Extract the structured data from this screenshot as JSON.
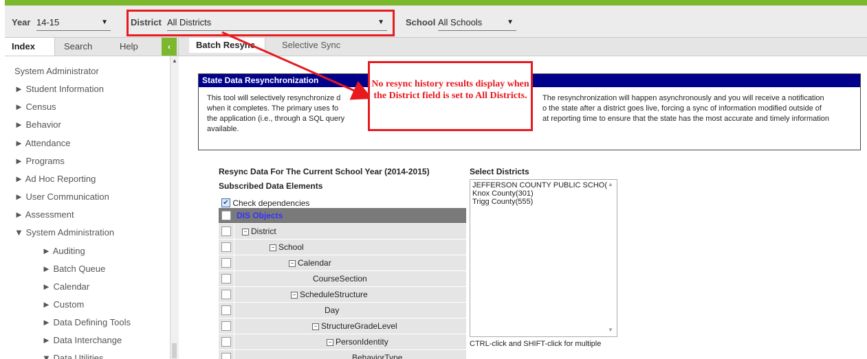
{
  "topbar": {
    "year_label": "Year",
    "year_value": "14-15",
    "district_label": "District",
    "district_value": "All Districts",
    "school_label": "School",
    "school_value": "All Schools"
  },
  "sidebar": {
    "tabs": [
      "Index",
      "Search",
      "Help"
    ],
    "collapse_glyph": "‹",
    "items": [
      {
        "label": "System Administrator"
      },
      {
        "label": "► Student Information"
      },
      {
        "label": "► Census"
      },
      {
        "label": "► Behavior"
      },
      {
        "label": "► Attendance"
      },
      {
        "label": "► Programs"
      },
      {
        "label": "► Ad Hoc Reporting"
      },
      {
        "label": "► User Communication"
      },
      {
        "label": "► Assessment"
      },
      {
        "label": "▼ System Administration"
      },
      {
        "label": "► Auditing"
      },
      {
        "label": "► Batch Queue"
      },
      {
        "label": "► Calendar"
      },
      {
        "label": "► Custom"
      },
      {
        "label": "► Data Defining Tools"
      },
      {
        "label": "► Data Interchange"
      },
      {
        "label": "▼ Data Utilities"
      }
    ]
  },
  "main": {
    "tabs": [
      "Batch Resync",
      "Selective Sync"
    ],
    "panel": {
      "title": "State Data Resynchronization",
      "line1_a": "This tool will selectively resynchronize d",
      "line1_b": "The resynchronization will happen asynchronously and you will receive a notification",
      "line2_a": "when it completes. The primary uses fo",
      "line2_b": "o the state after a district goes live, forcing a sync of information modified outside of",
      "line3_a": "the application (i.e., through a SQL query",
      "line3_b": "at reporting time to ensure that the state has the most accurate and timely information",
      "line4": "available."
    },
    "resync_heading": "Resync Data For The Current School Year (2014-2015)",
    "subscribed_heading": "Subscribed Data Elements",
    "check_dependencies": "Check dependencies",
    "tree": [
      {
        "label": "DIS Objects",
        "indent": 0,
        "toggle": false,
        "head": true
      },
      {
        "label": "District",
        "indent": 1,
        "toggle": true
      },
      {
        "label": "School",
        "indent": 2,
        "toggle": true
      },
      {
        "label": "Calendar",
        "indent": 3,
        "toggle": true
      },
      {
        "label": "CourseSection",
        "indent": 5,
        "toggle": false
      },
      {
        "label": "ScheduleStructure",
        "indent": 4,
        "toggle": true
      },
      {
        "label": "Day",
        "indent": 5,
        "toggle": false
      },
      {
        "label": "StructureGradeLevel",
        "indent": 5,
        "toggle": true
      },
      {
        "label": "PersonIdentity",
        "indent": 6,
        "toggle": true
      },
      {
        "label": "BehaviorType",
        "indent": 8,
        "toggle": false
      }
    ],
    "select_districts_heading": "Select Districts",
    "districts": [
      "JEFFERSON COUNTY PUBLIC SCHO(",
      "Knox County(301)",
      "Trigg County(555)"
    ],
    "multi_hint": "CTRL-click and SHIFT-click for multiple"
  },
  "annotation": {
    "callout_text": "No resync history results display when the District field is set to All Districts.",
    "color": "#e8191f"
  }
}
